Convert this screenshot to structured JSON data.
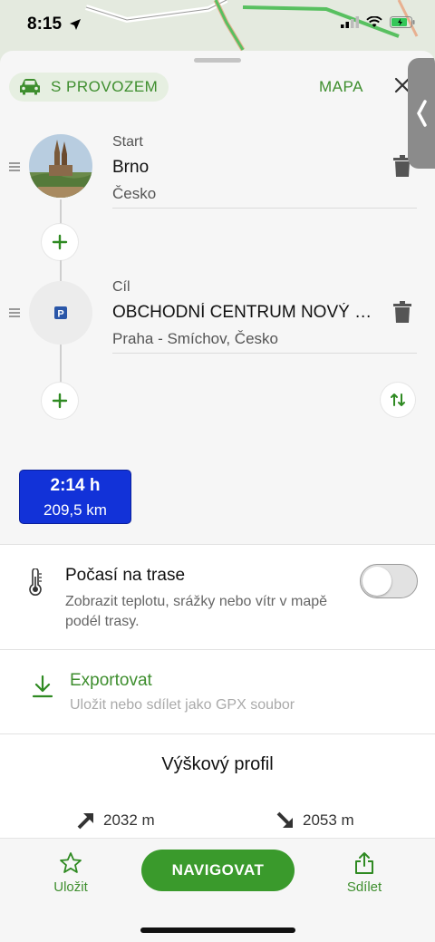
{
  "status": {
    "time": "8:15"
  },
  "header": {
    "mode_label": "S PROVOZEM",
    "map_label": "MAPA"
  },
  "start": {
    "kind": "Start",
    "name": "Brno",
    "sub": "Česko"
  },
  "destination": {
    "kind": "Cíl",
    "name": "OBCHODNÍ CENTRUM NOVÝ SMÍCHOV",
    "sub": "Praha - Smíchov, Česko"
  },
  "route": {
    "time": "2:14 h",
    "distance": "209,5 km"
  },
  "weather": {
    "title": "Počasí na trase",
    "description": "Zobrazit teplotu, srážky nebo vítr v mapě podél trasy.",
    "enabled": false
  },
  "export": {
    "title": "Exportovat",
    "description": "Uložit nebo sdílet jako GPX soubor"
  },
  "elevation": {
    "title": "Výškový profil",
    "ascent": "2032 m",
    "descent": "2053 m"
  },
  "bottom": {
    "save_label": "Uložit",
    "navigate_label": "NAVIGOVAT",
    "share_label": "Sdílet"
  },
  "colors": {
    "accent": "#3a9a2c",
    "route_badge": "#1232d8"
  }
}
